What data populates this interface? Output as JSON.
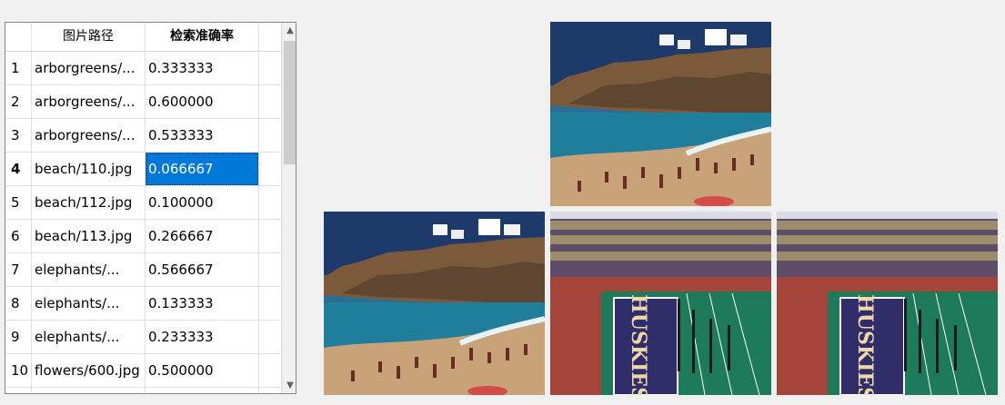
{
  "table": {
    "headers": [
      "",
      "图片路径",
      "检索准确率"
    ],
    "selected_row": 4,
    "rows": [
      {
        "index": "1",
        "path": "arborgreens/...",
        "accuracy": "0.333333"
      },
      {
        "index": "2",
        "path": "arborgreens/...",
        "accuracy": "0.600000"
      },
      {
        "index": "3",
        "path": "arborgreens/...",
        "accuracy": "0.533333"
      },
      {
        "index": "4",
        "path": "beach/110.jpg",
        "accuracy": "0.066667"
      },
      {
        "index": "5",
        "path": "beach/112.jpg",
        "accuracy": "0.100000"
      },
      {
        "index": "6",
        "path": "beach/113.jpg",
        "accuracy": "0.266667"
      },
      {
        "index": "7",
        "path": "elephants/...",
        "accuracy": "0.566667"
      },
      {
        "index": "8",
        "path": "elephants/...",
        "accuracy": "0.133333"
      },
      {
        "index": "9",
        "path": "elephants/...",
        "accuracy": "0.233333"
      },
      {
        "index": "10",
        "path": "flowers/600.jpg",
        "accuracy": "0.500000"
      },
      {
        "index": "",
        "path": "",
        "accuracy": ""
      }
    ]
  },
  "images": {
    "query": {
      "scene": "beach-cliff"
    },
    "results": [
      {
        "scene": "beach-cliff"
      },
      {
        "scene": "stadium-marching-band",
        "banner_text": "HUSKIES"
      },
      {
        "scene": "stadium-marching-band",
        "banner_text": "HUSKIES"
      }
    ]
  },
  "colors": {
    "selection": "#0078d7"
  }
}
